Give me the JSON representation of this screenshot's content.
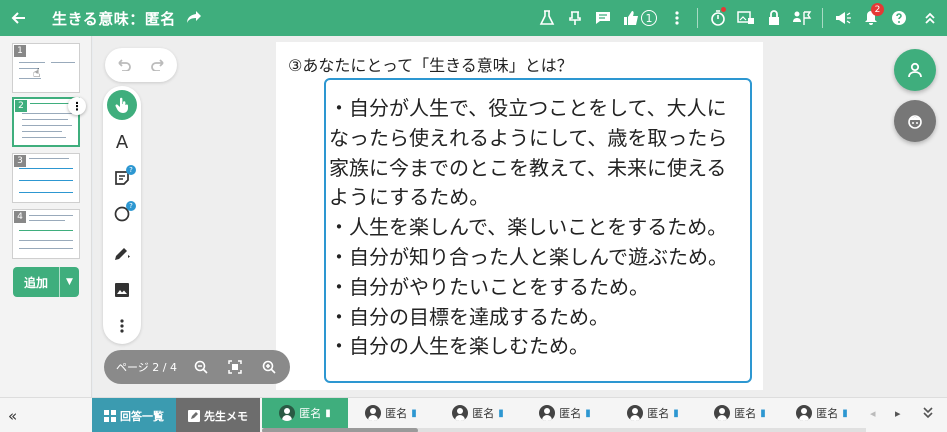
{
  "topbar": {
    "title": "生きる意味：匿名",
    "like_count": "1",
    "notification_count": "2"
  },
  "sidebar": {
    "pages": [
      "1",
      "2",
      "3",
      "4"
    ],
    "add_label": "追加"
  },
  "document": {
    "question": "③あなたにとって「生きる意味」とは？",
    "answer_lines": [
      "・自分が人生で、役立つことをして、大人に",
      "なったら使えれるようにして、歳を取ったら",
      "家族に今までのとこを教えて、未来に使える",
      "ようにするため。",
      "・人生を楽しんで、楽しいことをするため。",
      "・自分が知り合った人と楽しんで遊ぶため。",
      "・自分がやりたいことをするため。",
      "・自分の目標を達成するため。",
      "・自分の人生を楽しむため。"
    ]
  },
  "tools": {
    "text_tool": "A",
    "sticky_badge": "?",
    "shape_badge": "?"
  },
  "page_control": {
    "label": "ページ 2 / 4"
  },
  "bottombar": {
    "answer_list_label": "回答一覧",
    "teacher_memo_label": "先生メモ",
    "students": [
      "匿名",
      "匿名",
      "匿名",
      "匿名",
      "匿名",
      "匿名",
      "匿名"
    ]
  },
  "colors": {
    "brand_green": "#3fae7d",
    "answer_border": "#2d97d1",
    "list_button": "#3b9bb0",
    "memo_button": "#6d6d6d",
    "badge_red": "#e53935"
  },
  "icons": {
    "topbar": [
      "back-arrow-icon",
      "share-icon",
      "lab-icon",
      "pin-icon",
      "chat-icon",
      "thumbs-up-icon",
      "more-vert-icon",
      "timer-icon",
      "image-lock-icon",
      "lock-icon",
      "group-flag-icon",
      "megaphone-icon",
      "bell-icon",
      "help-icon",
      "collapse-up-icon"
    ]
  }
}
